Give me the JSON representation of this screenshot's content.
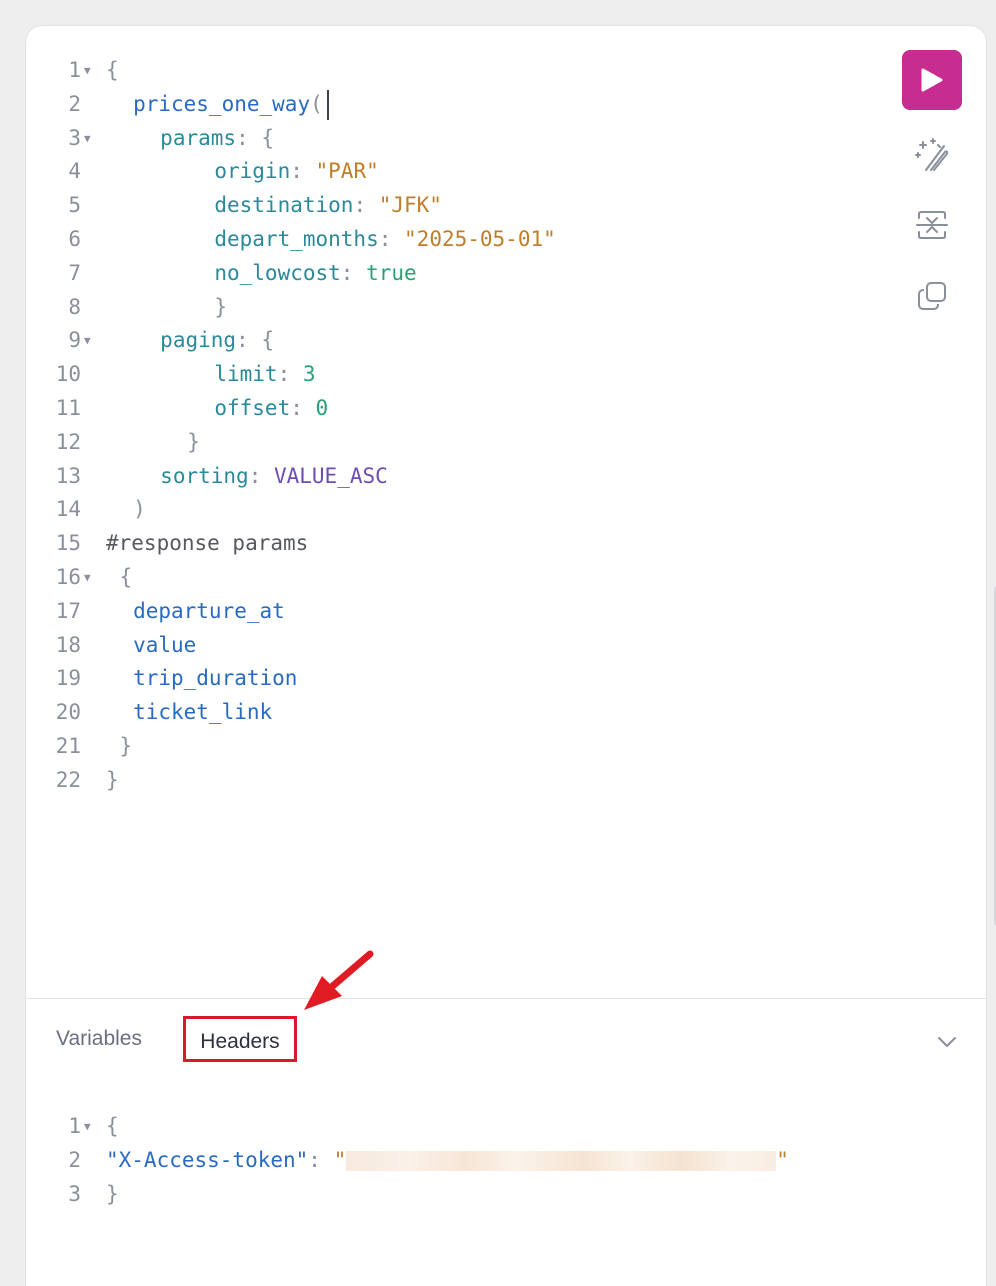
{
  "query_editor": {
    "lines": [
      {
        "num": "1",
        "fold": true,
        "indent": 0,
        "tokens": [
          {
            "t": "{",
            "c": "punct"
          }
        ]
      },
      {
        "num": "2",
        "fold": false,
        "indent": 2,
        "tokens": [
          {
            "t": "prices_one_way",
            "c": "field"
          },
          {
            "t": "(",
            "c": "punct"
          }
        ],
        "cursor": true
      },
      {
        "num": "3",
        "fold": true,
        "indent": 4,
        "tokens": [
          {
            "t": "params",
            "c": "arg"
          },
          {
            "t": ": {",
            "c": "punct"
          }
        ]
      },
      {
        "num": "4",
        "fold": false,
        "indent": 8,
        "tokens": [
          {
            "t": "origin",
            "c": "arg"
          },
          {
            "t": ": ",
            "c": "punct"
          },
          {
            "t": "\"PAR\"",
            "c": "str"
          }
        ]
      },
      {
        "num": "5",
        "fold": false,
        "indent": 8,
        "tokens": [
          {
            "t": "destination",
            "c": "arg"
          },
          {
            "t": ": ",
            "c": "punct"
          },
          {
            "t": "\"JFK\"",
            "c": "str"
          }
        ]
      },
      {
        "num": "6",
        "fold": false,
        "indent": 8,
        "tokens": [
          {
            "t": "depart_months",
            "c": "arg"
          },
          {
            "t": ": ",
            "c": "punct"
          },
          {
            "t": "\"2025-05-01\"",
            "c": "str"
          }
        ]
      },
      {
        "num": "7",
        "fold": false,
        "indent": 8,
        "tokens": [
          {
            "t": "no_lowcost",
            "c": "arg"
          },
          {
            "t": ": ",
            "c": "punct"
          },
          {
            "t": "true",
            "c": "bool"
          }
        ]
      },
      {
        "num": "8",
        "fold": false,
        "indent": 8,
        "tokens": [
          {
            "t": "}",
            "c": "punct"
          }
        ]
      },
      {
        "num": "9",
        "fold": true,
        "indent": 4,
        "tokens": [
          {
            "t": "paging",
            "c": "arg"
          },
          {
            "t": ": {",
            "c": "punct"
          }
        ]
      },
      {
        "num": "10",
        "fold": false,
        "indent": 8,
        "tokens": [
          {
            "t": "limit",
            "c": "arg"
          },
          {
            "t": ": ",
            "c": "punct"
          },
          {
            "t": "3",
            "c": "num"
          }
        ]
      },
      {
        "num": "11",
        "fold": false,
        "indent": 8,
        "tokens": [
          {
            "t": "offset",
            "c": "arg"
          },
          {
            "t": ": ",
            "c": "punct"
          },
          {
            "t": "0",
            "c": "num"
          }
        ]
      },
      {
        "num": "12",
        "fold": false,
        "indent": 6,
        "tokens": [
          {
            "t": "}",
            "c": "punct"
          }
        ]
      },
      {
        "num": "13",
        "fold": false,
        "indent": 4,
        "tokens": [
          {
            "t": "sorting",
            "c": "arg"
          },
          {
            "t": ": ",
            "c": "punct"
          },
          {
            "t": "VALUE_ASC",
            "c": "enum"
          }
        ]
      },
      {
        "num": "14",
        "fold": false,
        "indent": 2,
        "tokens": [
          {
            "t": ")",
            "c": "punct"
          }
        ]
      },
      {
        "num": "15",
        "fold": false,
        "indent": 0,
        "tokens": [
          {
            "t": "#response params",
            "c": "comment"
          }
        ]
      },
      {
        "num": "16",
        "fold": true,
        "indent": 1,
        "tokens": [
          {
            "t": "{",
            "c": "punct"
          }
        ]
      },
      {
        "num": "17",
        "fold": false,
        "indent": 2,
        "tokens": [
          {
            "t": "departure_at",
            "c": "field"
          }
        ]
      },
      {
        "num": "18",
        "fold": false,
        "indent": 2,
        "tokens": [
          {
            "t": "value",
            "c": "field"
          }
        ]
      },
      {
        "num": "19",
        "fold": false,
        "indent": 2,
        "tokens": [
          {
            "t": "trip_duration",
            "c": "field"
          }
        ]
      },
      {
        "num": "20",
        "fold": false,
        "indent": 2,
        "tokens": [
          {
            "t": "ticket_link",
            "c": "field"
          }
        ]
      },
      {
        "num": "21",
        "fold": false,
        "indent": 1,
        "tokens": [
          {
            "t": "}",
            "c": "punct"
          }
        ]
      },
      {
        "num": "22",
        "fold": false,
        "indent": 0,
        "tokens": [
          {
            "t": "}",
            "c": "punct"
          }
        ]
      }
    ]
  },
  "toolbar": {
    "run": {
      "icon": "play-icon",
      "color": "#c72d91"
    },
    "prettify": {
      "icon": "magic-wand-icon"
    },
    "merge": {
      "icon": "merge-fragments-icon"
    },
    "copy": {
      "icon": "copy-icon"
    }
  },
  "bottom_tabs": {
    "variables_label": "Variables",
    "headers_label": "Headers",
    "active": "Headers",
    "highlight_color": "#d9182a"
  },
  "headers_editor": {
    "lines": [
      {
        "num": "1",
        "fold": true,
        "indent": 0,
        "tokens": [
          {
            "t": "{",
            "c": "punct"
          }
        ]
      },
      {
        "num": "2",
        "fold": false,
        "indent": 0,
        "tokens": [
          {
            "t": "\"X-Access-token\"",
            "c": "field"
          },
          {
            "t": ": ",
            "c": "punct"
          },
          {
            "t": "\"",
            "c": "str"
          }
        ],
        "redacted": true,
        "tail": "\""
      },
      {
        "num": "3",
        "fold": false,
        "indent": 0,
        "tokens": [
          {
            "t": "}",
            "c": "punct"
          }
        ]
      }
    ]
  }
}
